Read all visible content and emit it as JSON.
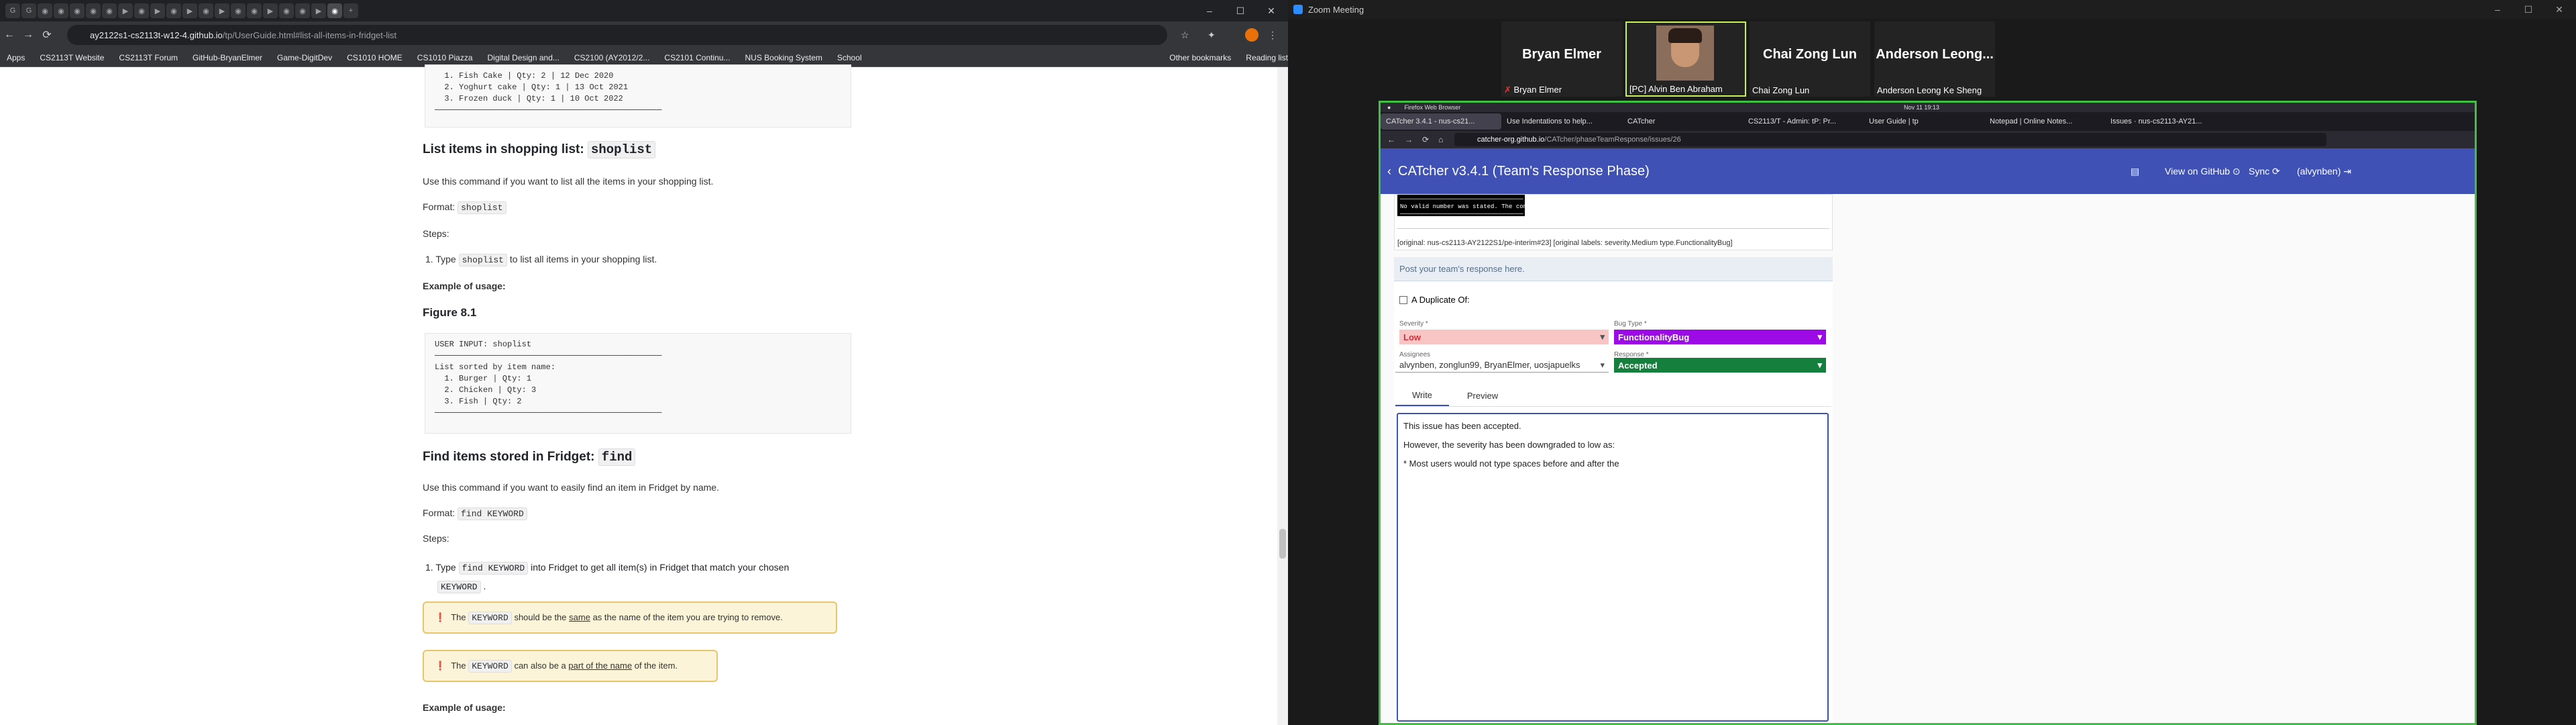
{
  "browser": {
    "url_host": "ay2122s1-cs2113t-w12-4.github.io",
    "url_path": "/tp/UserGuide.html#list-all-items-in-fridget-list",
    "bookmarks": [
      "Apps",
      "CS2113T Website",
      "CS2113T Forum",
      "GitHub-BryanElmer",
      "Game-DigitDev",
      "CS1010 HOME",
      "CS1010 Piazza",
      "Digital Design and...",
      "CS2100 (AY2012/2...",
      "CS2101 Continu...",
      "NUS Booking System",
      "School",
      "Other bookmarks",
      "Reading list"
    ]
  },
  "doc": {
    "top_code": "  1. Fish Cake | Qty: 2 | 12 Dec 2020\n  2. Yoghurt cake | Qty: 1 | 13 Oct 2021\n  3. Frozen duck | Qty: 1 | 10 Oct 2022\n───────────────────────────────────────────────",
    "shoplist_heading": "List items in shopping list:",
    "shoplist_cmd": "shoplist",
    "shoplist_desc": "Use this command if you want to list all the items in your shopping list.",
    "format_label": "Format:",
    "steps_label": "Steps:",
    "step1_a": "Type",
    "step1_b": "to list all items in your shopping list.",
    "example_label": "Example of usage:",
    "figure_label": "Figure 8.1",
    "figure_code": "USER INPUT: shoplist\n───────────────────────────────────────────────\nList sorted by item name:\n  1. Burger | Qty: 1\n  2. Chicken | Qty: 3\n  3. Fish | Qty: 2\n───────────────────────────────────────────────",
    "find_heading": "Find items stored in Fridget:",
    "find_cmd": "find",
    "find_desc": "Use this command if you want to easily find an item in Fridget by name.",
    "find_format": "find KEYWORD",
    "find_step_a": "Type",
    "find_step_b": "into Fridget to get all item(s) in Fridget that match your chosen",
    "keyword": "KEYWORD",
    "alert1_a": "The",
    "alert1_b": "should be the",
    "alert1_u": "same",
    "alert1_c": "as the name of the item you are trying to remove.",
    "alert2_a": "The",
    "alert2_b": "can also be a",
    "alert2_u": "part of the name",
    "alert2_c": "of the item.",
    "example_label2": "Example of usage:"
  },
  "zoom": {
    "window_title": "Zoom Meeting",
    "participants": [
      {
        "name": "Bryan Elmer",
        "label": "Bryan Elmer"
      },
      {
        "name": "",
        "label": "[PC] Alvin Ben Abraham"
      },
      {
        "name": "Chai Zong Lun",
        "label": "Chai Zong Lun"
      },
      {
        "name": "Anderson Leong...",
        "label": "Anderson Leong Ke Sheng"
      }
    ]
  },
  "shared": {
    "ff_app": "Firefox Web Browser",
    "ff_time": "Nov 11 19:13",
    "tabs": [
      "CATcher 3.4.1 - nus-cs21...",
      "Use Indentations to help...",
      "CATcher",
      "CS2113/T - Admin: tP: Pr...",
      "User Guide | tp",
      "Notepad | Online Notes...",
      "Issues · nus-cs2113-AY21..."
    ],
    "url_host": "catcher-org.github.io",
    "url_path": "/CATcher/phaseTeamResponse/issues/26",
    "app_title": "CATcher v3.4.1  (Team's Response Phase)",
    "view_github": "View on GitHub",
    "sync": "Sync",
    "user": "(alvynben)",
    "terminal": "──────────────────────────────────\nNo valid number was stated. The command has been shutdown.\n──────────────────────────────────\nUSER INPUT:",
    "meta": "[original: nus-cs2113-AY2122S1/pe-interim#23] [original labels: severity.Medium type.FunctionalityBug]",
    "post_prompt": "Post your team's response here.",
    "duplicate": "A Duplicate Of:",
    "severity_label": "Severity *",
    "severity": "Low",
    "bugtype_label": "Bug Type *",
    "bugtype": "FunctionalityBug",
    "assignees_label": "Assignees",
    "assignees": "alvynben, zonglun99, BryanElmer, uosjapuelks",
    "response_label": "Response *",
    "response": "Accepted",
    "tab_write": "Write",
    "tab_preview": "Preview",
    "editor_lines": [
      "This issue has been accepted.",
      "However, the severity has been downgraded to low as:",
      "* Most users would not type spaces before and after the"
    ]
  },
  "colors": {
    "indigo": "#3f51b5",
    "low": "#f8c5c5",
    "purple": "#9c0ae6",
    "green": "#15803d",
    "share_border": "#3fc244"
  }
}
